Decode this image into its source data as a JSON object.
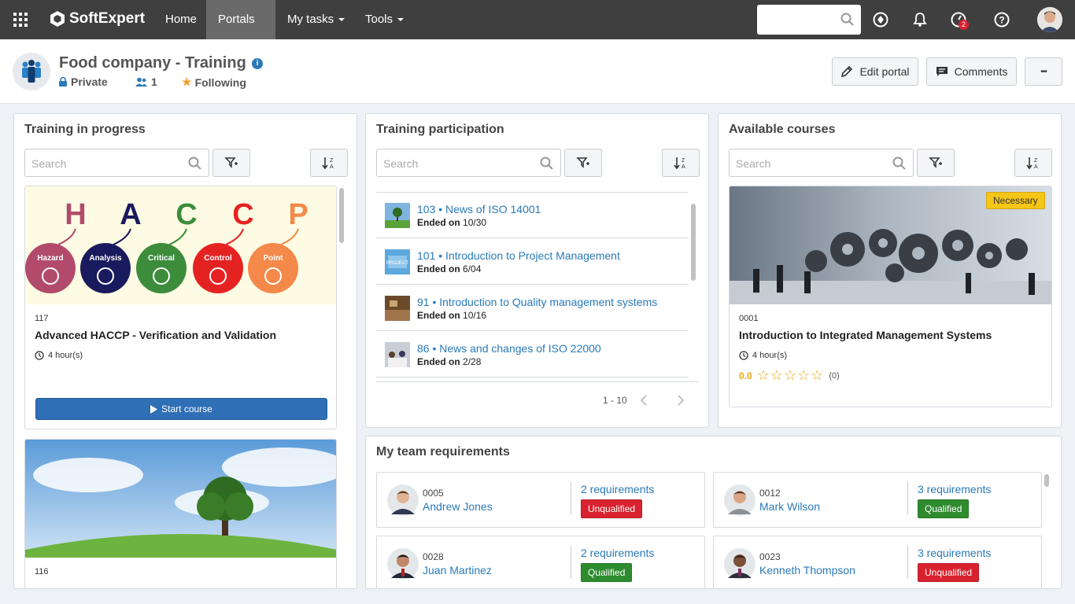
{
  "nav": {
    "brand": "SoftExpert",
    "items": [
      {
        "label": "Home"
      },
      {
        "label": "Portals"
      },
      {
        "label": "My tasks"
      },
      {
        "label": "Tools"
      }
    ],
    "notif_count": "2"
  },
  "header": {
    "title": "Food company - Training",
    "privacy": "Private",
    "members": "1",
    "following": "Following",
    "edit_label": "Edit portal",
    "comments_label": "Comments",
    "more_label": "•••"
  },
  "training_progress": {
    "title": "Training in progress",
    "search_placeholder": "Search",
    "hacc_letters": [
      "H",
      "A",
      "C",
      "C",
      "P"
    ],
    "hacc_words": [
      "Hazard",
      "Analysis",
      "Critical",
      "Control",
      "Point"
    ],
    "hacc_colors": [
      "#b24b6b",
      "#1a1a5e",
      "#3c8c3c",
      "#e52222",
      "#f5894a"
    ],
    "card1": {
      "code": "117",
      "name": "Advanced HACCP - Verification and Validation",
      "hours": "4 hour(s)",
      "button": "Start course"
    },
    "card2": {
      "code": "116"
    }
  },
  "participation": {
    "title": "Training participation",
    "search_placeholder": "Search",
    "items": [
      {
        "title": "103 • News of ISO 14001",
        "ended_label": "Ended on",
        "ended": "10/30"
      },
      {
        "title": "101 • Introduction to Project Management",
        "ended_label": "Ended on",
        "ended": "6/04"
      },
      {
        "title": "91 • Introduction to Quality management systems",
        "ended_label": "Ended on",
        "ended": "10/16"
      },
      {
        "title": "86 • News and changes of ISO 22000",
        "ended_label": "Ended on",
        "ended": "2/28"
      }
    ],
    "pager": "1 - 10"
  },
  "available": {
    "title": "Available courses",
    "search_placeholder": "Search",
    "tag": "Necessary",
    "code": "0001",
    "name": "Introduction to Integrated Management Systems",
    "hours": "4 hour(s)",
    "rating": "0.0",
    "rating_count": "(0)"
  },
  "team": {
    "title": "My team requirements",
    "members": [
      {
        "code": "0005",
        "name": "Andrew Jones",
        "req": "2 requirements",
        "status": "Unqualified"
      },
      {
        "code": "0012",
        "name": "Mark Wilson",
        "req": "3 requirements",
        "status": "Qualified"
      },
      {
        "code": "0028",
        "name": "Juan Martinez",
        "req": "2 requirements",
        "status": "Qualified"
      },
      {
        "code": "0023",
        "name": "Kenneth Thompson",
        "req": "3 requirements",
        "status": "Unqualified"
      }
    ]
  },
  "colors": {
    "unqualified": "#d9222f",
    "qualified": "#2e8b2e",
    "primary": "#2f6fb5",
    "nav": "#3f3f3f"
  }
}
